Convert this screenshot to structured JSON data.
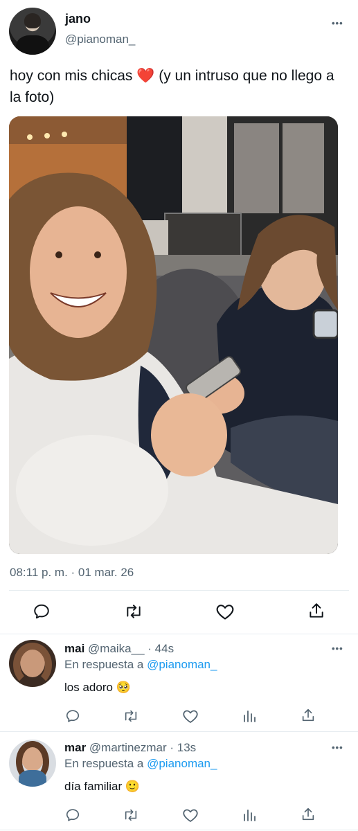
{
  "tweet": {
    "author_name": "jano",
    "author_handle": "@pianoman_",
    "text": "hoy con mis chicas ❤️  (y un intruso que no llego a la foto)",
    "timestamp": "08:11 p. m. · 01 mar. 26",
    "more_label": "•••"
  },
  "replies": [
    {
      "name": "mai",
      "handle": "@maika__",
      "time": "· 44s",
      "reply_prefix": "En respuesta a",
      "reply_to": "@pianoman_",
      "text": "los adoro 🥺",
      "more_label": "•••"
    },
    {
      "name": "mar",
      "handle": "@martinezmar",
      "time": "· 13s",
      "reply_prefix": "En respuesta a",
      "reply_to": "@pianoman_",
      "text": "día familiar 🙂",
      "more_label": "•••"
    }
  ],
  "colors": {
    "accent": "#1d9bf0",
    "muted": "#536471",
    "divider": "#e6ecf0"
  }
}
